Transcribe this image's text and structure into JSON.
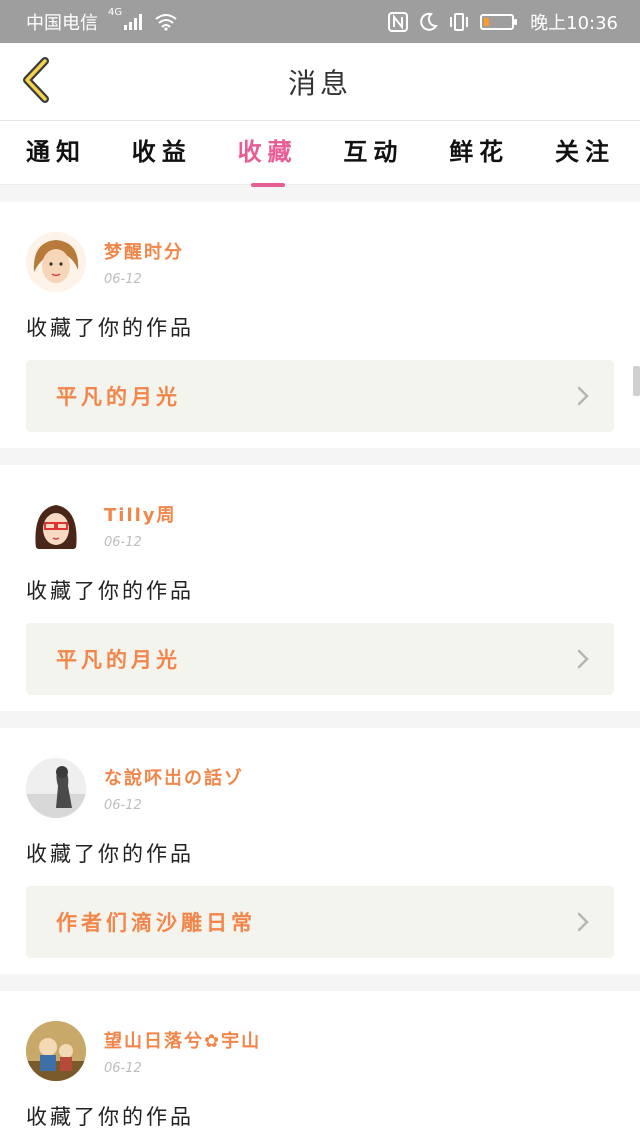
{
  "status_bar": {
    "carrier": "中国电信",
    "network": "4G",
    "time": "晚上10:36",
    "battery_fraction": 0.2,
    "battery_color": "#ff9a2b"
  },
  "header": {
    "title": "消息",
    "back_icon": "chevron-left-icon"
  },
  "tabs": [
    {
      "label": "通知",
      "active": false
    },
    {
      "label": "收益",
      "active": false
    },
    {
      "label": "收藏",
      "active": true
    },
    {
      "label": "互动",
      "active": false
    },
    {
      "label": "鲜花",
      "active": false
    },
    {
      "label": "关注",
      "active": false
    }
  ],
  "colors": {
    "accent": "#e75d95",
    "username": "#f2864a",
    "work_box_bg": "#f4f4ef"
  },
  "messages": [
    {
      "username": "梦醒时分",
      "date": "06-12",
      "action": "收藏了你的作品",
      "work_title": "平凡的月光"
    },
    {
      "username": "Tilly周",
      "date": "06-12",
      "action": "收藏了你的作品",
      "work_title": "平凡的月光"
    },
    {
      "username": "な說吥岀の話ゾ",
      "date": "06-12",
      "action": "收藏了你的作品",
      "work_title": "作者们滴沙雕日常"
    },
    {
      "username": "望山日落兮✿宇山",
      "date": "06-12",
      "action": "收藏了你的作品",
      "work_title": ""
    }
  ]
}
